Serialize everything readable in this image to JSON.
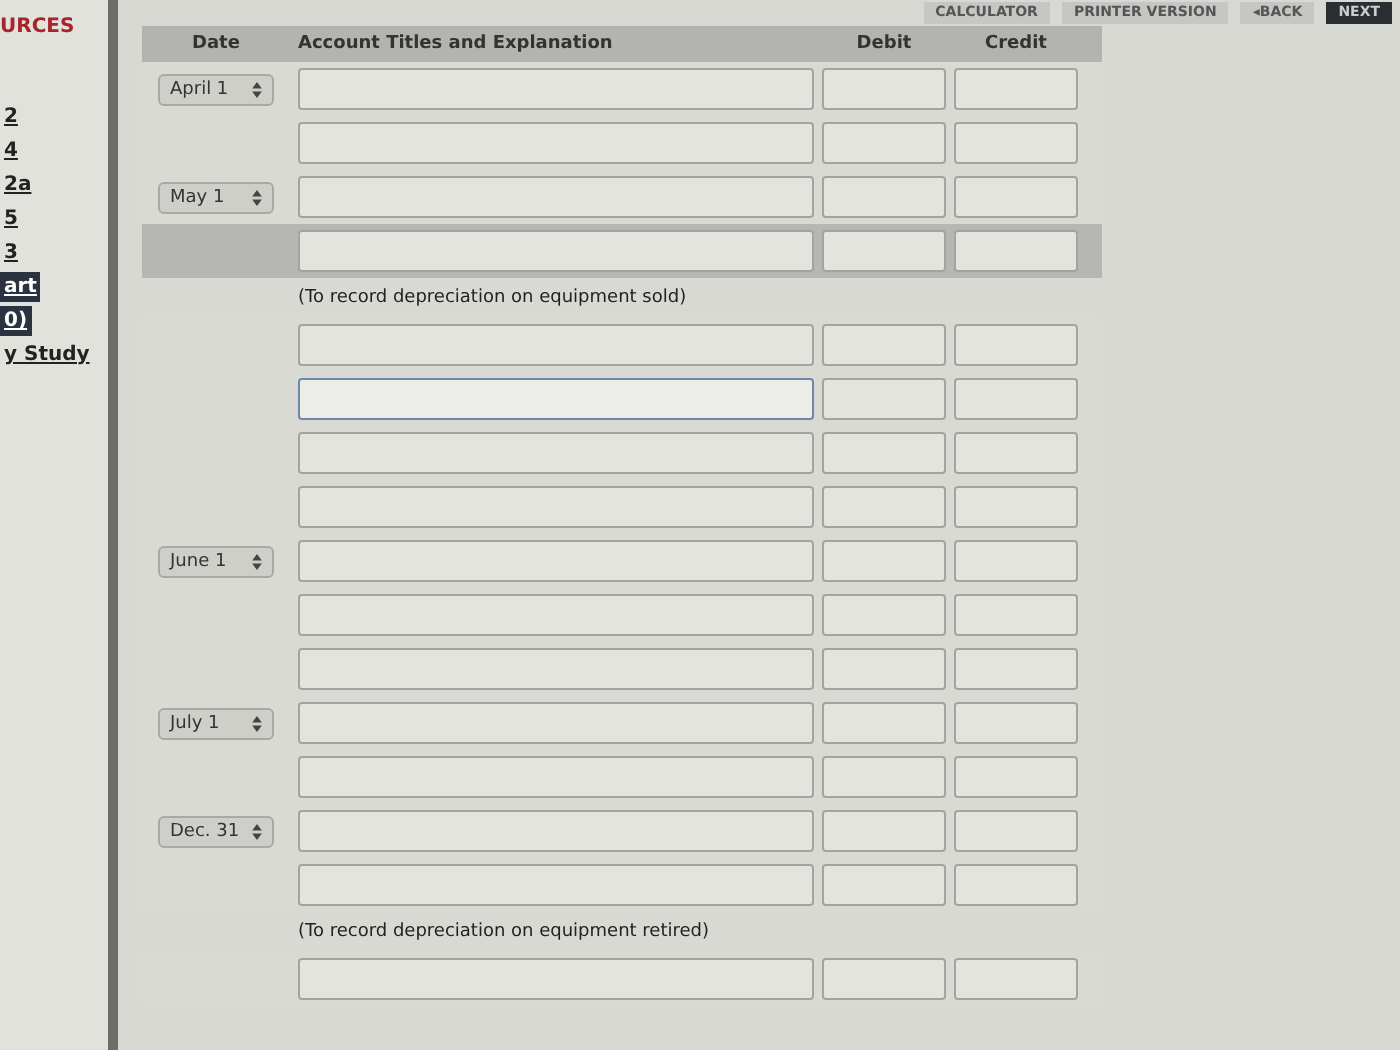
{
  "top_buttons": [
    {
      "label": "CALCULATOR",
      "kind": "plain"
    },
    {
      "label": "PRINTER VERSION",
      "kind": "plain"
    },
    {
      "label": "◂BACK",
      "kind": "plain"
    },
    {
      "label": "NEXT",
      "kind": "dark"
    }
  ],
  "sidebar": {
    "heading": "URCES",
    "links": [
      {
        "label": "2",
        "kind": "link"
      },
      {
        "label": "4",
        "kind": "link"
      },
      {
        "label": "2a",
        "kind": "link"
      },
      {
        "label": "5",
        "kind": "link"
      },
      {
        "label": "3",
        "kind": "link"
      },
      {
        "label": "art",
        "kind": "dark"
      },
      {
        "label": "0)",
        "kind": "dark"
      },
      {
        "label": "y Study",
        "kind": "link"
      }
    ]
  },
  "table": {
    "columns": [
      "Date",
      "Account Titles and Explanation",
      "Debit",
      "Credit"
    ],
    "rows": [
      {
        "kind": "line",
        "date": "April 1",
        "highlighted": false,
        "focused": false
      },
      {
        "kind": "line",
        "highlighted": false,
        "focused": false
      },
      {
        "kind": "line",
        "date": "May 1",
        "highlighted": false,
        "focused": false
      },
      {
        "kind": "line",
        "highlighted": true,
        "focused": false
      },
      {
        "kind": "note",
        "text": "(To record depreciation on equipment sold)"
      },
      {
        "kind": "line",
        "highlighted": false,
        "focused": false
      },
      {
        "kind": "line",
        "highlighted": false,
        "focused": true
      },
      {
        "kind": "line",
        "highlighted": false,
        "focused": false
      },
      {
        "kind": "line",
        "highlighted": false,
        "focused": false
      },
      {
        "kind": "line",
        "date": "June 1",
        "highlighted": false,
        "focused": false
      },
      {
        "kind": "line",
        "highlighted": false,
        "focused": false
      },
      {
        "kind": "line",
        "highlighted": false,
        "focused": false
      },
      {
        "kind": "line",
        "date": "July 1",
        "highlighted": false,
        "focused": false
      },
      {
        "kind": "line",
        "highlighted": false,
        "focused": false
      },
      {
        "kind": "line",
        "date": "Dec. 31",
        "highlighted": false,
        "focused": false
      },
      {
        "kind": "line",
        "highlighted": false,
        "focused": false
      },
      {
        "kind": "note",
        "text": "(To record depreciation on equipment retired)"
      },
      {
        "kind": "line",
        "highlighted": false,
        "focused": false
      }
    ]
  }
}
